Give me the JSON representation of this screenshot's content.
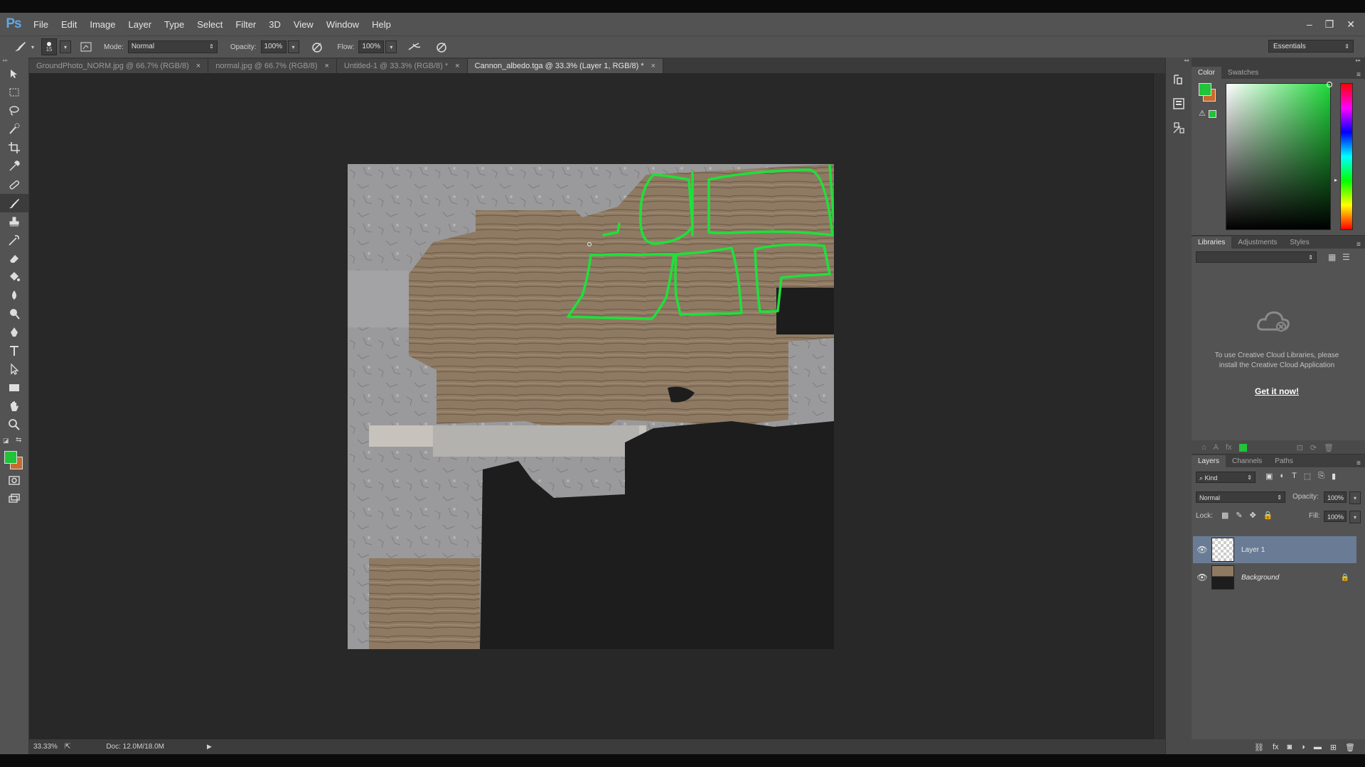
{
  "app": {
    "logo": "Ps",
    "menu": [
      "File",
      "Edit",
      "Image",
      "Layer",
      "Type",
      "Select",
      "Filter",
      "3D",
      "View",
      "Window",
      "Help"
    ],
    "window_controls": [
      "–",
      "❐",
      "✕"
    ]
  },
  "options_bar": {
    "brush_size": "15",
    "mode_label": "Mode:",
    "mode_value": "Normal",
    "opacity_label": "Opacity:",
    "opacity_value": "100%",
    "flow_label": "Flow:",
    "flow_value": "100%",
    "workspace": "Essentials"
  },
  "tabs": [
    {
      "label": "GroundPhoto_NORM.jpg @ 66.7% (RGB/8)",
      "active": false
    },
    {
      "label": "normal.jpg @ 66.7% (RGB/8)",
      "active": false
    },
    {
      "label": "Untitled-1 @ 33.3% (RGB/8) *",
      "active": false
    },
    {
      "label": "Cannon_albedo.tga @ 33.3% (Layer 1, RGB/8) *",
      "active": true
    }
  ],
  "status": {
    "zoom": "33.33%",
    "doc": "Doc: 12.0M/18.0M"
  },
  "colors": {
    "foreground": "#22c23a",
    "background": "#c86a2e",
    "stroke": "#1fe03a"
  },
  "color_panel": {
    "tabs": [
      "Color",
      "Swatches"
    ]
  },
  "libraries_panel": {
    "tabs": [
      "Libraries",
      "Adjustments",
      "Styles"
    ],
    "message": "To use Creative Cloud Libraries, please install the Creative Cloud Application",
    "link": "Get it now!"
  },
  "layers_panel": {
    "tabs": [
      "Layers",
      "Channels",
      "Paths"
    ],
    "filter": "Kind",
    "blend_mode": "Normal",
    "opacity_label": "Opacity:",
    "opacity_value": "100%",
    "lock_label": "Lock:",
    "fill_label": "Fill:",
    "fill_value": "100%",
    "layers": [
      {
        "name": "Layer 1",
        "selected": true
      },
      {
        "name": "Background",
        "selected": false
      }
    ]
  }
}
